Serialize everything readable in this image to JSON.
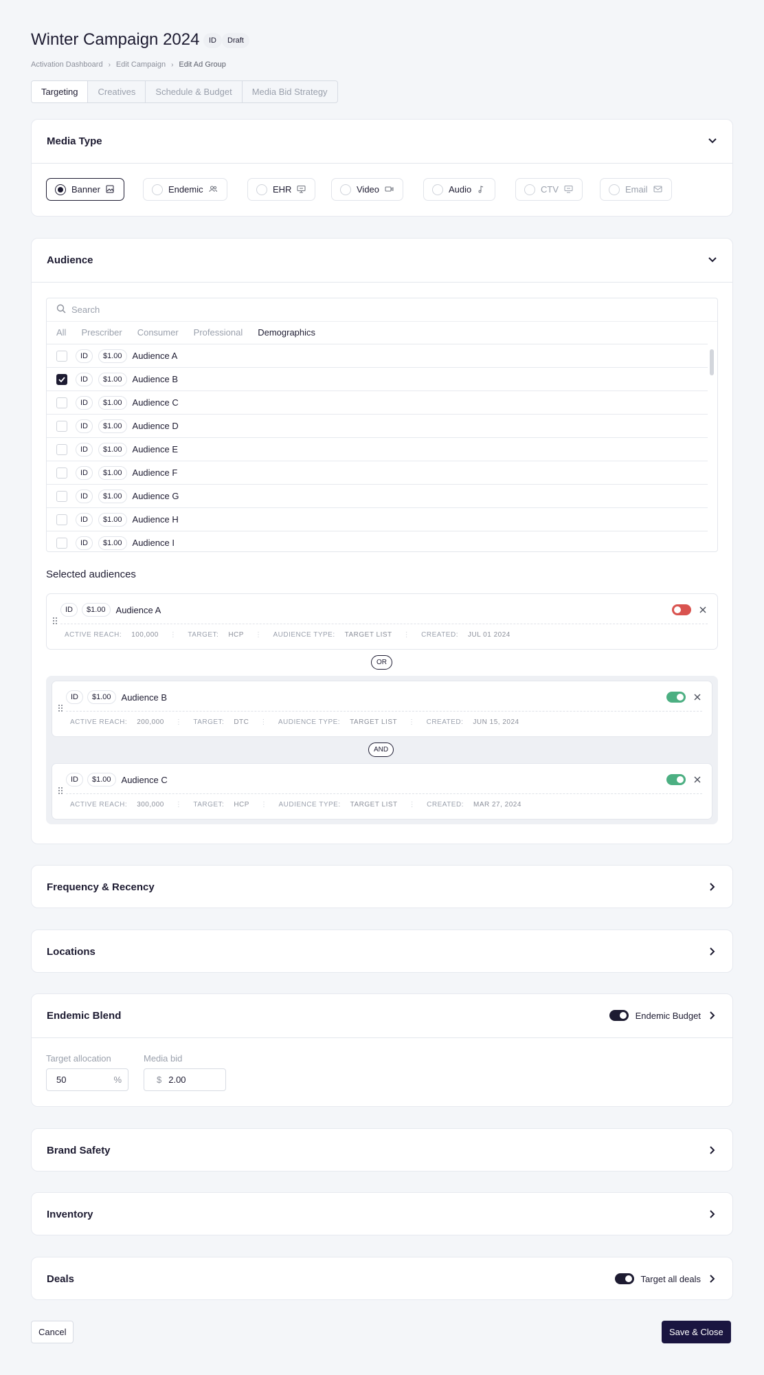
{
  "header": {
    "title": "Winter Campaign 2024",
    "id_badge": "ID",
    "status_badge": "Draft"
  },
  "breadcrumbs": [
    "Activation Dashboard",
    "Edit Campaign",
    "Edit Ad Group"
  ],
  "tabs": [
    "Targeting",
    "Creatives",
    "Schedule & Budget",
    "Media Bid Strategy"
  ],
  "active_tab": "Targeting",
  "media_type": {
    "title": "Media Type",
    "options": [
      {
        "label": "Banner",
        "icon": "image-icon",
        "selected": true
      },
      {
        "label": "Endemic",
        "icon": "users-icon",
        "selected": false
      },
      {
        "label": "EHR",
        "icon": "monitor-icon",
        "selected": false
      },
      {
        "label": "Video",
        "icon": "video-icon",
        "selected": false
      },
      {
        "label": "Audio",
        "icon": "music-icon",
        "selected": false
      },
      {
        "label": "CTV",
        "icon": "tv-icon",
        "selected": false
      },
      {
        "label": "Email",
        "icon": "mail-icon",
        "selected": false
      }
    ]
  },
  "audience": {
    "title": "Audience",
    "search_placeholder": "Search",
    "filters": [
      "All",
      "Prescriber",
      "Consumer",
      "Professional",
      "Demographics"
    ],
    "active_filter": "Demographics",
    "rows": [
      {
        "id": "ID",
        "price": "$1.00",
        "name": "Audience A",
        "checked": false
      },
      {
        "id": "ID",
        "price": "$1.00",
        "name": "Audience B",
        "checked": true
      },
      {
        "id": "ID",
        "price": "$1.00",
        "name": "Audience C",
        "checked": false
      },
      {
        "id": "ID",
        "price": "$1.00",
        "name": "Audience D",
        "checked": false
      },
      {
        "id": "ID",
        "price": "$1.00",
        "name": "Audience E",
        "checked": false
      },
      {
        "id": "ID",
        "price": "$1.00",
        "name": "Audience F",
        "checked": false
      },
      {
        "id": "ID",
        "price": "$1.00",
        "name": "Audience G",
        "checked": false
      },
      {
        "id": "ID",
        "price": "$1.00",
        "name": "Audience H",
        "checked": false
      },
      {
        "id": "ID",
        "price": "$1.00",
        "name": "Audience I",
        "checked": false
      }
    ],
    "selected_title": "Selected audiences",
    "meta_labels": {
      "reach": "ACTIVE REACH:",
      "target": "TARGET:",
      "type": "AUDIENCE TYPE:",
      "created": "CREATED:"
    },
    "selected": [
      {
        "id": "ID",
        "price": "$1.00",
        "name": "Audience A",
        "enabled": false,
        "reach": "100,000",
        "target": "HCP",
        "type": "TARGET LIST",
        "created": "JUL 01 2024"
      },
      {
        "id": "ID",
        "price": "$1.00",
        "name": "Audience B",
        "enabled": true,
        "reach": "200,000",
        "target": "DTC",
        "type": "TARGET LIST",
        "created": "JUN 15, 2024"
      },
      {
        "id": "ID",
        "price": "$1.00",
        "name": "Audience C",
        "enabled": true,
        "reach": "300,000",
        "target": "HCP",
        "type": "TARGET LIST",
        "created": "MAR 27, 2024"
      }
    ],
    "logic_or": "OR",
    "logic_and": "AND"
  },
  "sections": {
    "frequency": "Frequency & Recency",
    "locations": "Locations",
    "endemic": "Endemic Blend",
    "endemic_toggle_label": "Endemic Budget",
    "brand_safety": "Brand Safety",
    "inventory": "Inventory",
    "deals": "Deals",
    "deals_toggle_label": "Target all deals"
  },
  "endemic_fields": {
    "allocation_label": "Target allocation",
    "allocation_value": "50",
    "allocation_suffix": "%",
    "bid_label": "Media bid",
    "bid_prefix": "$",
    "bid_value": "2.00"
  },
  "footer": {
    "cancel": "Cancel",
    "save": "Save & Close"
  },
  "colors": {
    "primary": "#1a1540",
    "toggle_off": "#d9534f",
    "toggle_on": "#4caf82"
  }
}
